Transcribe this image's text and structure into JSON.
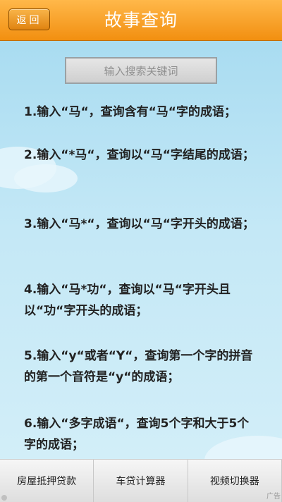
{
  "header": {
    "back_label": "返回",
    "title": "故事查询"
  },
  "search": {
    "placeholder": "输入搜索关键词"
  },
  "tips": [
    "1.输入“马“，查询含有“马“字的成语；",
    "2.输入“*马“，查询以“马“字结尾的成语；",
    "3.输入“马*“，查询以“马“字开头的成语；",
    "4.输入“马*功“，查询以“马“字开头且以“功“字开头的成语；",
    "5.输入“y“或者“Y“，查询第一个字的拼音的第一个音符是“y“的成语；",
    "6.输入“多字成语“，查询5个字和大于5个字的成语；"
  ],
  "tabs": [
    {
      "label": "房屋抵押贷款"
    },
    {
      "label": "车贷计算器"
    },
    {
      "label": "视频切换器"
    }
  ],
  "ad_mark": "广告",
  "colors": {
    "header_orange": "#f28f10",
    "background_blue": "#bfe6f6"
  }
}
